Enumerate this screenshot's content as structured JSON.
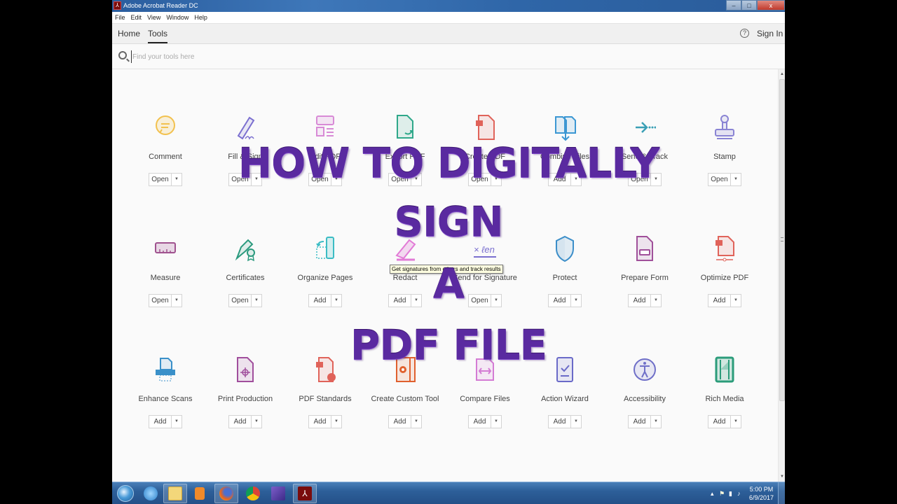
{
  "window": {
    "title": "Adobe Acrobat Reader DC",
    "app_icon": "acrobat-icon",
    "controls": {
      "minimize": "–",
      "maximize": "□",
      "close": "x"
    }
  },
  "menubar": {
    "items": [
      "File",
      "Edit",
      "View",
      "Window",
      "Help"
    ]
  },
  "nav": {
    "tabs": [
      {
        "label": "Home",
        "active": false
      },
      {
        "label": "Tools",
        "active": true
      }
    ],
    "help_icon": "?",
    "sign_in": "Sign In"
  },
  "search": {
    "value": "",
    "placeholder": "Find your tools here"
  },
  "tools": [
    {
      "label": "Comment",
      "button": "Open",
      "icon": "comment-icon",
      "color": "#f2c14e"
    },
    {
      "label": "Fill & Sign",
      "button": "Open",
      "icon": "fill-sign-icon",
      "color": "#7b6fd0"
    },
    {
      "label": "Edit PDF",
      "button": "Open",
      "icon": "edit-pdf-icon",
      "color": "#d88ad6"
    },
    {
      "label": "Export PDF",
      "button": "Open",
      "icon": "export-pdf-icon",
      "color": "#2fa88a"
    },
    {
      "label": "Create PDF",
      "button": "Open",
      "icon": "create-pdf-icon",
      "color": "#e0635a"
    },
    {
      "label": "Combine Files",
      "button": "Add",
      "icon": "combine-files-icon",
      "color": "#3b97d3"
    },
    {
      "label": "Send & Track",
      "button": "Open",
      "icon": "send-track-icon",
      "color": "#3a9fb5"
    },
    {
      "label": "Stamp",
      "button": "Open",
      "icon": "stamp-icon",
      "color": "#8a84d4"
    },
    {
      "label": "Measure",
      "button": "Open",
      "icon": "measure-icon",
      "color": "#a0528f"
    },
    {
      "label": "Certificates",
      "button": "Open",
      "icon": "certificates-icon",
      "color": "#2b9a7e"
    },
    {
      "label": "Organize Pages",
      "button": "Add",
      "icon": "organize-pages-icon",
      "color": "#3bbcc4"
    },
    {
      "label": "Redact",
      "button": "Add",
      "icon": "redact-icon",
      "color": "#e27ad6"
    },
    {
      "label": "Send for Signature",
      "button": "Open",
      "icon": "send-signature-icon",
      "color": "#7a6fcf"
    },
    {
      "label": "Protect",
      "button": "Add",
      "icon": "protect-icon",
      "color": "#3b8ec9"
    },
    {
      "label": "Prepare Form",
      "button": "Add",
      "icon": "prepare-form-icon",
      "color": "#a0509a"
    },
    {
      "label": "Optimize PDF",
      "button": "Add",
      "icon": "optimize-pdf-icon",
      "color": "#e0635a"
    },
    {
      "label": "Enhance Scans",
      "button": "Add",
      "icon": "enhance-scans-icon",
      "color": "#3a90c9"
    },
    {
      "label": "Print Production",
      "button": "Add",
      "icon": "print-production-icon",
      "color": "#a04e9c"
    },
    {
      "label": "PDF Standards",
      "button": "Add",
      "icon": "pdf-standards-icon",
      "color": "#e0635a"
    },
    {
      "label": "Create Custom Tool",
      "button": "Add",
      "icon": "custom-tool-icon",
      "color": "#e0602e"
    },
    {
      "label": "Compare Files",
      "button": "Add",
      "icon": "compare-files-icon",
      "color": "#d47bd4"
    },
    {
      "label": "Action Wizard",
      "button": "Add",
      "icon": "action-wizard-icon",
      "color": "#6a6ac8"
    },
    {
      "label": "Accessibility",
      "button": "Add",
      "icon": "accessibility-icon",
      "color": "#6f6fc8"
    },
    {
      "label": "Rich Media",
      "button": "Add",
      "icon": "rich-media-icon",
      "color": "#2b9c7a"
    }
  ],
  "tooltip": "Get signatures from others and track results",
  "overlay_title": {
    "lines": [
      "HOW TO DIGITALLY",
      "SIGN",
      "A",
      "PDF FILE"
    ],
    "color": "#5a2aa0"
  },
  "taskbar": {
    "items": [
      {
        "name": "start-button",
        "icon": "windows-start-icon"
      },
      {
        "name": "internet-explorer",
        "icon": "internet-explorer-icon"
      },
      {
        "name": "file-explorer",
        "icon": "folder-icon"
      },
      {
        "name": "media-player",
        "icon": "media-player-icon"
      },
      {
        "name": "firefox",
        "icon": "firefox-icon"
      },
      {
        "name": "chrome",
        "icon": "chrome-icon"
      },
      {
        "name": "visual-studio",
        "icon": "visual-studio-icon"
      },
      {
        "name": "acrobat-reader",
        "icon": "acrobat-icon"
      }
    ],
    "time": "5:00 PM",
    "date": "6/9/2017"
  }
}
